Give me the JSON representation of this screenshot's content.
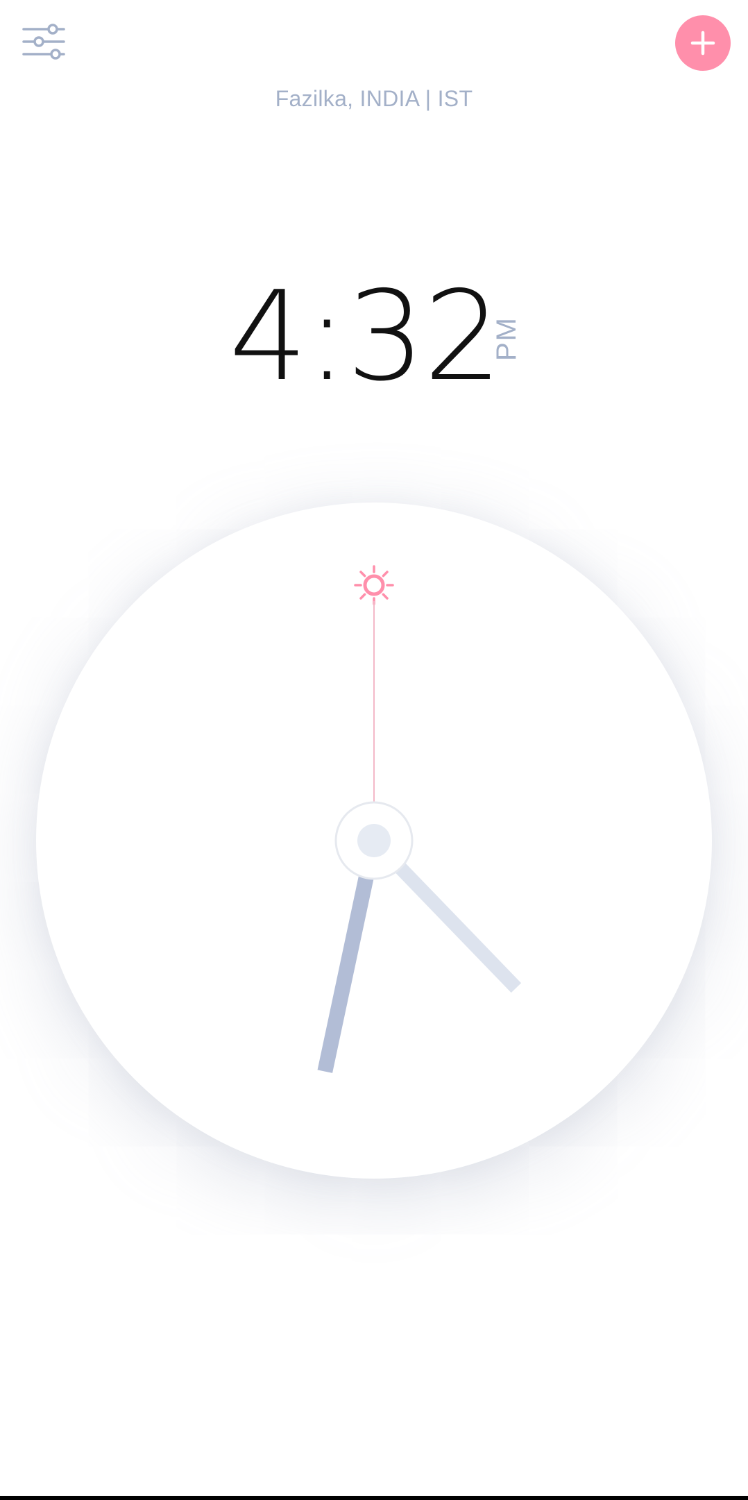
{
  "header": {
    "settings_icon": "sliders-icon",
    "add_icon": "plus-icon",
    "location": "Fazilka, INDIA | IST"
  },
  "time": {
    "digits": "4:32",
    "period": "PM"
  },
  "clock": {
    "hour": 4,
    "minute": 32,
    "second": 0,
    "sun_icon": "sun-icon"
  },
  "colors": {
    "accent": "#ff8fab",
    "muted": "#a3b0c8",
    "hand_light": "#dde3ee",
    "hand_dark": "#b2bdd6",
    "text": "#111111"
  }
}
